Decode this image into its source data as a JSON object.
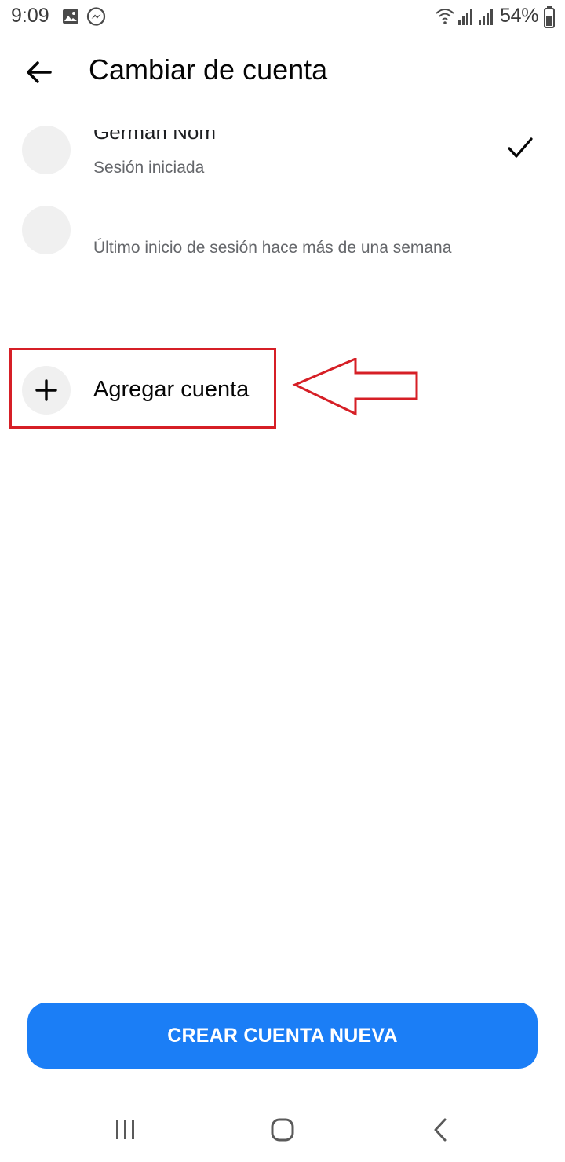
{
  "status_bar": {
    "time": "9:09",
    "battery": "54%",
    "icons": [
      "gallery-icon",
      "messenger-icon",
      "wifi-icon",
      "signal-icon",
      "signal-icon",
      "battery-icon"
    ]
  },
  "header": {
    "title": "Cambiar de cuenta",
    "back_icon": "arrow-left-icon"
  },
  "accounts": [
    {
      "name": "German Nom",
      "status": "Sesión iniciada",
      "selected": true
    },
    {
      "status": "Último inicio de sesión hace más de una semana",
      "selected": false
    }
  ],
  "add_account": {
    "label": "Agregar cuenta",
    "icon": "plus-icon"
  },
  "create_button": {
    "label": "CREAR CUENTA NUEVA"
  },
  "colors": {
    "primary": "#1b7ef6",
    "annotation": "#d61f26",
    "secondary_text": "#65676b"
  }
}
